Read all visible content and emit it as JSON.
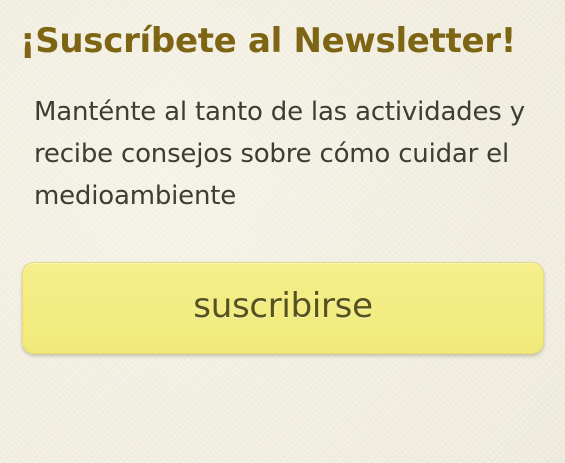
{
  "newsletter": {
    "title": "¡Suscríbete al Newsletter!",
    "description": "Manténte al tanto de las actividades y recibe consejos sobre cómo cuidar el medioambiente",
    "button_label": "suscribirse"
  },
  "colors": {
    "background": "#f3f0e3",
    "title": "#7d6514",
    "text": "#3d3d37",
    "button": "#f3ec81",
    "button_text": "#55521f"
  }
}
